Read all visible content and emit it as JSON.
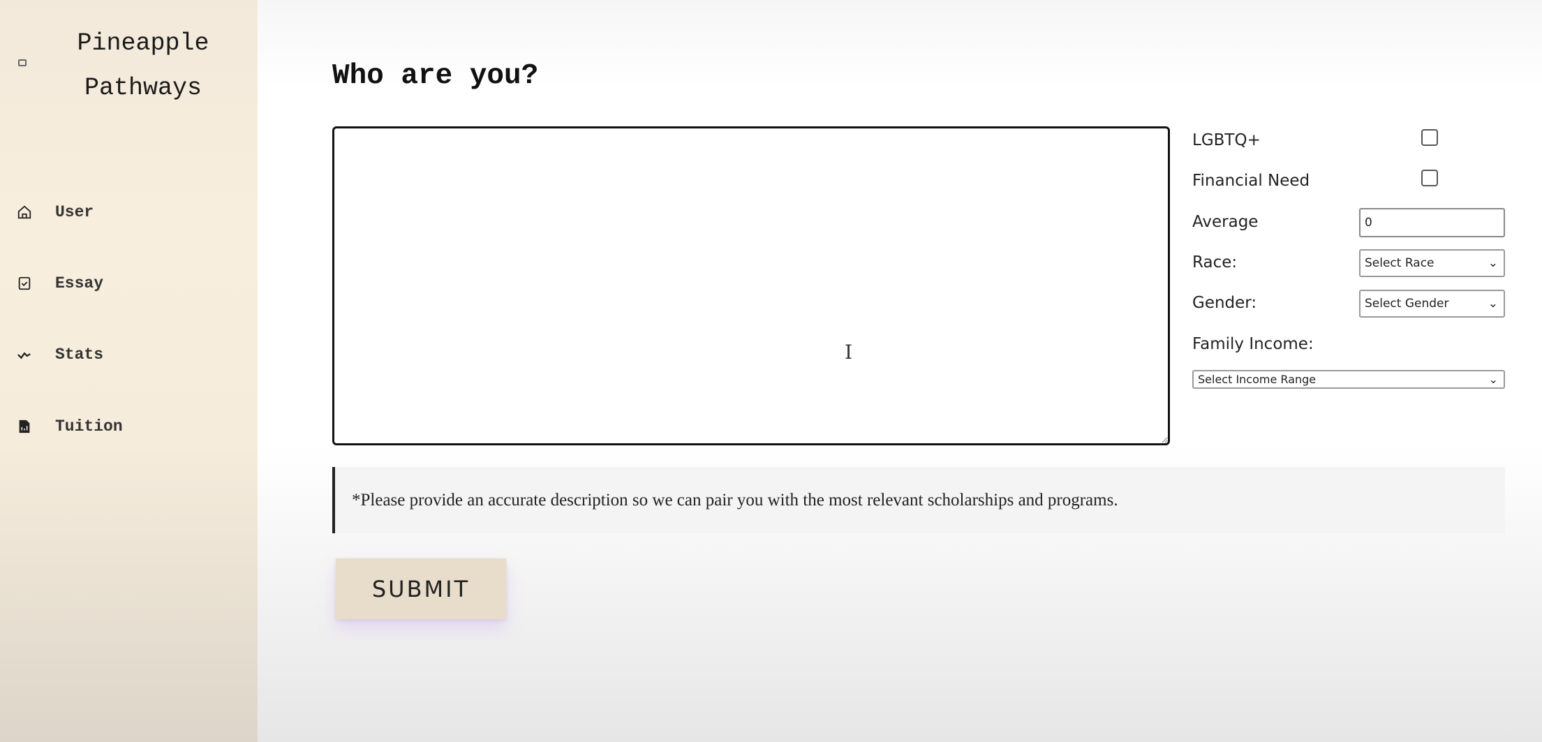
{
  "sidebar": {
    "brand_line1": "Pineapple",
    "brand_line2": "Pathways",
    "items": [
      {
        "label": "User",
        "icon": "home-icon"
      },
      {
        "label": "Essay",
        "icon": "clipboard-check-icon"
      },
      {
        "label": "Stats",
        "icon": "activity-icon"
      },
      {
        "label": "Tuition",
        "icon": "document-icon"
      }
    ]
  },
  "main": {
    "title": "Who are you?",
    "description_value": "",
    "form": {
      "lgbtq_label": "LGBTQ+",
      "lgbtq_checked": false,
      "financial_need_label": "Financial Need",
      "financial_need_checked": false,
      "average_label": "Average",
      "average_value": "0",
      "race_label": "Race:",
      "race_value": "Select Race",
      "gender_label": "Gender:",
      "gender_value": "Select Gender",
      "income_label": "Family Income:",
      "income_value": "Select Income Range"
    },
    "note": "*Please provide an accurate description so we can pair you with the most relevant scholarships and programs.",
    "submit_label": "SUBMIT"
  }
}
